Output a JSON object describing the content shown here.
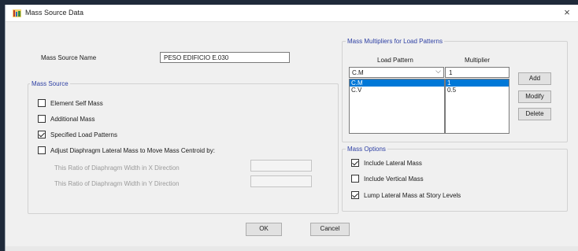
{
  "window": {
    "title": "Mass Source Data",
    "close_glyph": "×"
  },
  "name_field": {
    "label": "Mass Source Name",
    "value": "PESO EDIFICIO E.030"
  },
  "mass_source": {
    "group_label": "Mass Source",
    "options": [
      {
        "label": "Element Self Mass",
        "checked": false
      },
      {
        "label": "Additional Mass",
        "checked": false
      },
      {
        "label": "Specified Load Patterns",
        "checked": true
      },
      {
        "label": "Adjust Diaphragm Lateral Mass to Move Mass Centroid by:",
        "checked": false
      }
    ],
    "ratio_x_label": "This Ratio of Diaphragm Width in X Direction",
    "ratio_y_label": "This Ratio of Diaphragm Width in Y Direction",
    "ratio_x_value": "",
    "ratio_y_value": ""
  },
  "multipliers": {
    "group_label": "Mass Multipliers for Load Patterns",
    "col_load_pattern": "Load Pattern",
    "col_multiplier": "Multiplier",
    "combo_value": "C.M",
    "combo_chevron": "⌵",
    "input_value": "1",
    "patterns": [
      "C.M",
      "C.V"
    ],
    "values": [
      "1",
      "0.5"
    ],
    "selected_index": 0,
    "add_label": "Add",
    "modify_label": "Modify",
    "delete_label": "Delete"
  },
  "mass_options": {
    "group_label": "Mass Options",
    "options": [
      {
        "label": "Include Lateral Mass",
        "checked": true
      },
      {
        "label": "Include Vertical Mass",
        "checked": false
      },
      {
        "label": "Lump Lateral Mass at Story Levels",
        "checked": true
      }
    ]
  },
  "footer": {
    "ok_label": "OK",
    "cancel_label": "Cancel"
  },
  "colors": {
    "accent": "#2d3fa3",
    "selection": "#0078d7"
  }
}
